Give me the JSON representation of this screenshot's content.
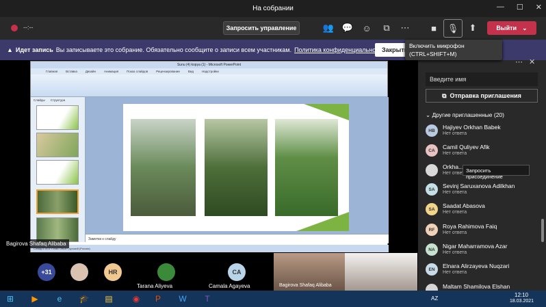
{
  "window": {
    "title": "На собрании",
    "controls": [
      "—",
      "☐",
      "✕"
    ]
  },
  "meeting": {
    "timer": "--:--",
    "request_control": "Запросить управление",
    "leave": "Выйти"
  },
  "banner": {
    "label": "Идет запись",
    "text": "Вы записываете это собрание. Обязательно сообщите о записи всем участникам.",
    "link": "Политика конфиденциальности",
    "close": "Закрыть"
  },
  "tooltip": {
    "line1": "Включить микрофон",
    "line2": "(CTRL+SHIFT+M)"
  },
  "ppt": {
    "title": "Sunu (4) kopya (1) - Microsoft PowerPoint",
    "tabs": [
      "Главная",
      "Вставка",
      "Дизайн",
      "Анимация",
      "Показ слайдов",
      "Рецензирование",
      "Вид",
      "Надстройки"
    ],
    "pane_tabs": [
      "Слайды",
      "Структура"
    ],
    "notes": "Заметки к слайду",
    "status": "Слайд 6 из 8  «Тема Office»  русский (Россия)"
  },
  "presenter": "Bagirova Shafaq Alibaba",
  "strip": {
    "more": "+31",
    "p1_initials": "HR",
    "p2_name": "Tarana Aliyeva",
    "p3_initials": "CA",
    "p3_name": "Camala Agayeva",
    "vid1_name": "Bagirova Shafaq Alibaba"
  },
  "panel": {
    "search_placeholder": "Введите имя",
    "invite": "Отправка приглашения",
    "header": "Другие приглашенные (20)"
  },
  "people": [
    {
      "initials": "HB",
      "name": "Hajiyev Orkhan Babek",
      "status": "Нет ответа",
      "color": "#b8c9e0"
    },
    {
      "initials": "CA",
      "name": "Camil Quliyev Afik",
      "status": "Нет ответа",
      "color": "#e9c2c2"
    },
    {
      "initials": "",
      "name": "Orkha...",
      "status": "Нет ответа",
      "color": "#d9d9d9"
    },
    {
      "initials": "SA",
      "name": "Sevinj Saruxanova Adilkhan",
      "status": "Нет ответа",
      "color": "#c6e0e8"
    },
    {
      "initials": "SA",
      "name": "Saadat Abasova",
      "status": "Нет ответа",
      "color": "#f2d48a"
    },
    {
      "initials": "RF",
      "name": "Roya Rahimova Faiq",
      "status": "Нет ответа",
      "color": "#f0d2b8"
    },
    {
      "initials": "NA",
      "name": "Nigar Maharramova Azar",
      "status": "Нет ответа",
      "color": "#c7e3d0"
    },
    {
      "initials": "EN",
      "name": "Elnara Alirzayeva Nuqzari",
      "status": "Нет ответа",
      "color": "#c7dbe8"
    },
    {
      "initials": "",
      "name": "Maltam Shamilova Elshan",
      "status": "",
      "color": "#d5d5d5"
    }
  ],
  "ask_tip": "Запросить присоединение",
  "taskbar": {
    "lang": "AZ",
    "time": "12:10",
    "date": "18.03.2021"
  }
}
